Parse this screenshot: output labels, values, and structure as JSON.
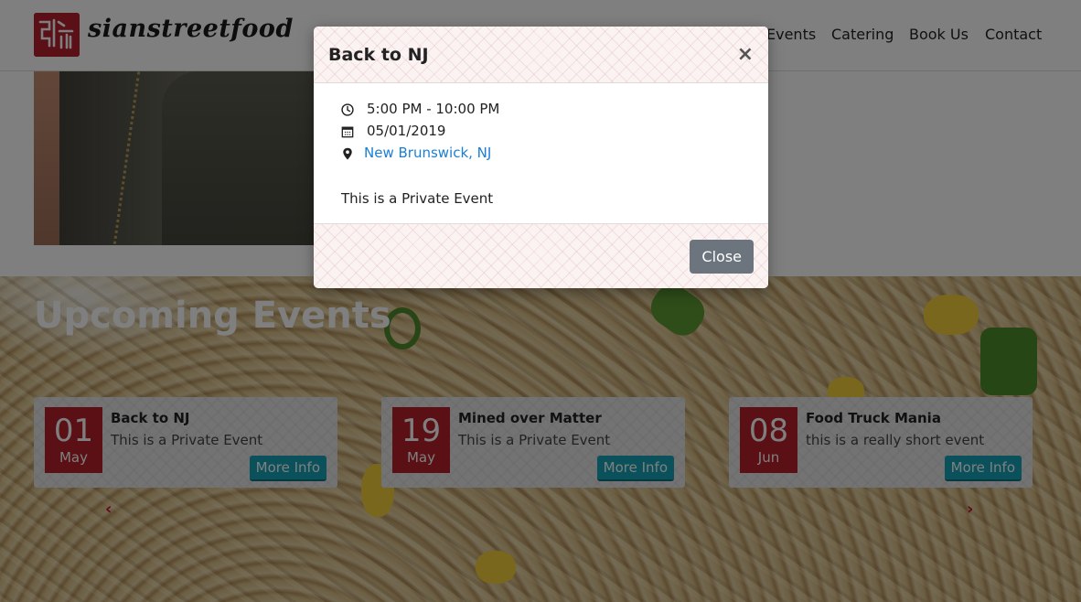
{
  "brand": {
    "logo_alt": "siansteetfood logo",
    "name": "sianstreetfood"
  },
  "nav": {
    "items": [
      {
        "label": "Events"
      },
      {
        "label": "Catering"
      },
      {
        "label": "Book Us"
      },
      {
        "label": "Contact"
      }
    ]
  },
  "events_section": {
    "title": "Upcoming Events",
    "cards": [
      {
        "day": "01",
        "month": "May",
        "title": "Back to NJ",
        "description": "This is a Private Event",
        "button": "More Info"
      },
      {
        "day": "19",
        "month": "May",
        "title": "Mined over Matter",
        "description": "This is a Private Event",
        "button": "More Info"
      },
      {
        "day": "08",
        "month": "Jun",
        "title": "Food Truck Mania",
        "description": "this is a really short event",
        "button": "More Info"
      }
    ],
    "prev_arrow": "‹",
    "next_arrow": "›"
  },
  "modal": {
    "title": "Back to NJ",
    "close_x": "×",
    "time": "5:00 PM - 10:00 PM",
    "date": "05/01/2019",
    "location": "New Brunswick, NJ",
    "description": "This is a Private Event",
    "close_button": "Close"
  },
  "colors": {
    "brand_red": "#b5202b",
    "teal_button": "#17a2b8",
    "link_blue": "#1a7fd4",
    "secondary_button": "#6c757d"
  }
}
